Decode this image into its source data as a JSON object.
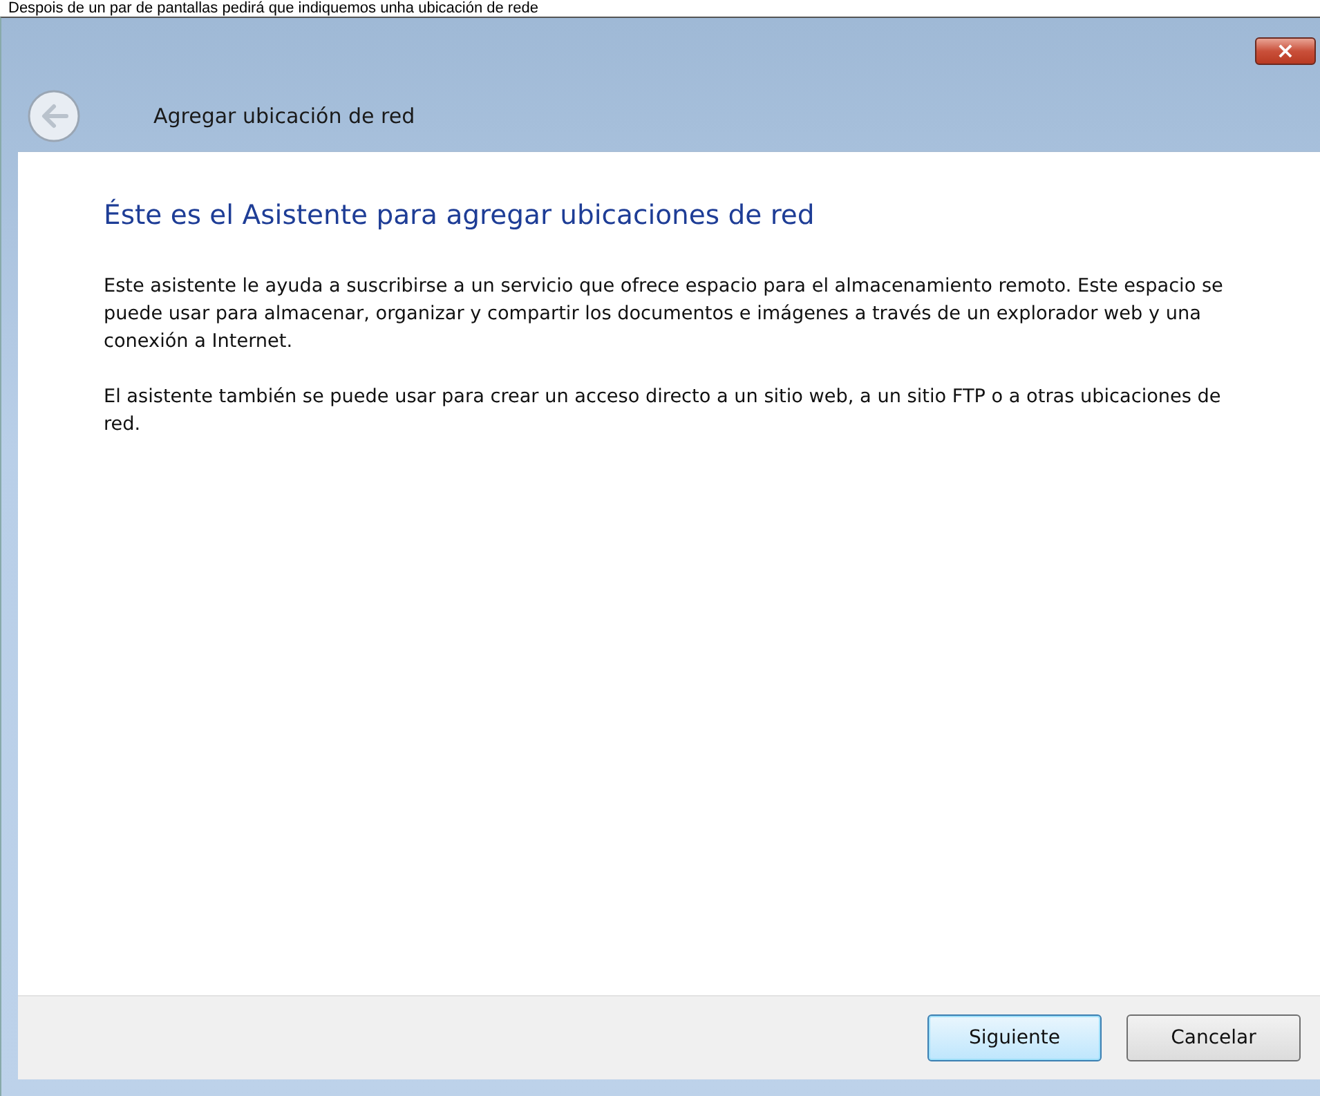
{
  "caption": "Despois de un par de pantallas pedirá que indiquemos unha ubicación de rede",
  "window": {
    "title": "Agregar ubicación de red",
    "close": "×"
  },
  "content": {
    "heading": "Éste es el Asistente para agregar ubicaciones de red",
    "paragraphs": [
      "Este asistente le ayuda a suscribirse a un servicio que ofrece espacio para el almacenamiento remoto. Este espacio se puede usar para almacenar, organizar y compartir los documentos e imágenes a través de un explorador web y una conexión a Internet.",
      "El asistente también se puede usar para crear un acceso directo a un sitio web, a un sitio FTP o a otras ubicaciones de red."
    ]
  },
  "buttons": [
    {
      "label": "Siguiente",
      "kind": "default"
    },
    {
      "label": "Cancelar",
      "kind": "normal"
    }
  ]
}
